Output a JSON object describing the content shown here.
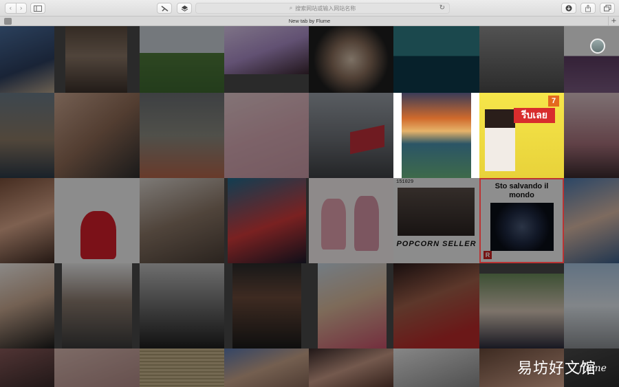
{
  "toolbar": {
    "back_icon": "chevron-left-icon",
    "forward_icon": "chevron-right-icon",
    "sidebar_icon": "sidebar-icon",
    "tools_icon": "tools-icon",
    "layers_icon": "layers-icon",
    "address_placeholder": "搜索网站或输入网站名称",
    "reload_icon": "reload-icon",
    "download_icon": "download-icon",
    "share_icon": "share-icon",
    "tabs_icon": "tabs-overview-icon"
  },
  "tab": {
    "title": "New tab by Flume",
    "new_tab_label": "+"
  },
  "caption_tile": {
    "text": "Sto salvando il mondo",
    "badge": "R"
  },
  "popcorn_tile": {
    "date": "151029",
    "text": "POPCORN SELLER"
  },
  "ad_tile": {
    "headline": "รีบเลย",
    "brand": "7"
  },
  "watermark": {
    "text": "易坊好文馆",
    "brand": "flume"
  }
}
